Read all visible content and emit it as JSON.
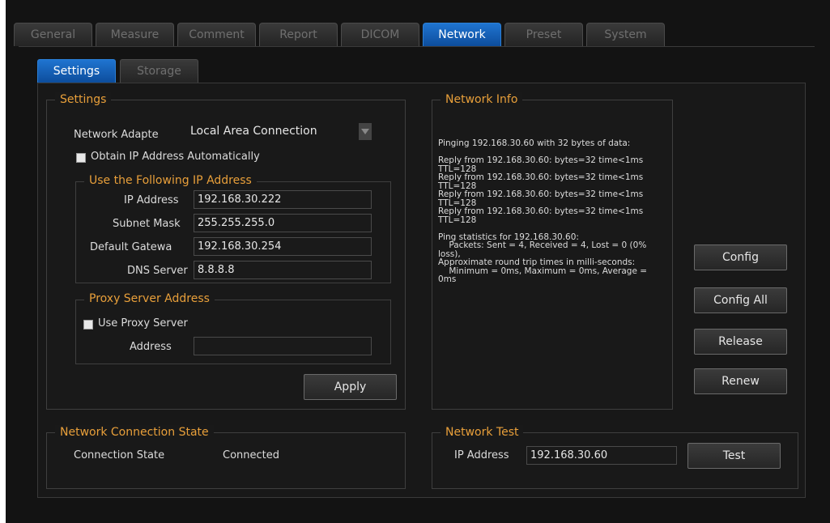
{
  "main_tabs": [
    "General",
    "Measure",
    "Comment",
    "Report",
    "DICOM",
    "Network",
    "Preset",
    "System"
  ],
  "sub_tabs": [
    "Settings",
    "Storage"
  ],
  "settings": {
    "legend": "Settings",
    "network_adapter_label": "Network Adapte",
    "network_adapter_value": "Local Area Connection",
    "obtain_auto_label": "Obtain IP Address Automatically",
    "manual": {
      "legend": "Use the Following IP Address",
      "ip_label": "IP Address",
      "ip_value": "192.168.30.222",
      "subnet_label": "Subnet Mask",
      "subnet_value": "255.255.255.0",
      "gateway_label": "Default Gatewa",
      "gateway_value": "192.168.30.254",
      "dns_label": "DNS Server",
      "dns_value": "8.8.8.8"
    },
    "proxy": {
      "legend": "Proxy Server Address",
      "use_proxy_label": "Use Proxy Server",
      "address_label": "Address",
      "address_value": ""
    },
    "apply_label": "Apply"
  },
  "network_info": {
    "legend": "Network Info",
    "lines": [
      "Pinging 192.168.30.60 with 32 bytes of data:",
      "",
      "Reply from 192.168.30.60: bytes=32 time<1ms",
      "TTL=128",
      "Reply from 192.168.30.60: bytes=32 time<1ms",
      "TTL=128",
      "Reply from 192.168.30.60: bytes=32 time<1ms",
      "TTL=128",
      "Reply from 192.168.30.60: bytes=32 time<1ms",
      "TTL=128",
      "",
      "Ping statistics for 192.168.30.60:",
      "    Packets: Sent = 4, Received = 4, Lost = 0 (0%",
      "loss),",
      "Approximate round trip times in milli-seconds:",
      "    Minimum = 0ms, Maximum = 0ms, Average =",
      "0ms"
    ]
  },
  "side_buttons": {
    "config": "Config",
    "config_all": "Config All",
    "release": "Release",
    "renew": "Renew"
  },
  "connection_state": {
    "legend": "Network Connection State",
    "label": "Connection State",
    "value": "Connected"
  },
  "network_test": {
    "legend": "Network Test",
    "ip_label": "IP Address",
    "ip_value": "192.168.30.60",
    "test_label": "Test"
  },
  "colors": {
    "accent_tab": "#1565c0",
    "legend_orange": "#e89f3a",
    "background": "#131313"
  }
}
